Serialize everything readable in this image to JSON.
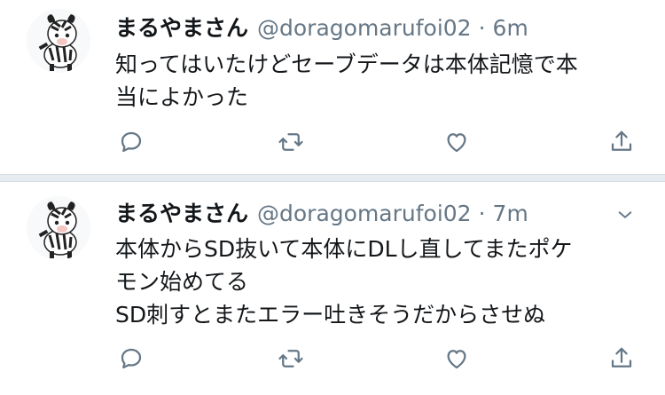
{
  "colors": {
    "text": "#14171a",
    "secondary": "#657786",
    "divider": "#e6ecf0"
  },
  "tweets": [
    {
      "display_name": "まるやまさん",
      "handle": "@doragomarufoi02",
      "separator": "·",
      "time": "6m",
      "lines": [
        "知ってはいたけどセーブデータは本体記憶で本",
        "当によかった"
      ],
      "avatar_icon": "zebra-avatar",
      "actions": [
        "reply-icon",
        "retweet-icon",
        "like-icon",
        "share-icon"
      ]
    },
    {
      "display_name": "まるやまさん",
      "handle": "@doragomarufoi02",
      "separator": "·",
      "time": "7m",
      "lines": [
        "本体からSD抜いて本体にDLし直してまたポケ",
        "モン始めてる",
        "SD刺すとまたエラー吐きそうだからさせぬ"
      ],
      "avatar_icon": "zebra-avatar",
      "actions": [
        "reply-icon",
        "retweet-icon",
        "like-icon",
        "share-icon"
      ]
    }
  ]
}
